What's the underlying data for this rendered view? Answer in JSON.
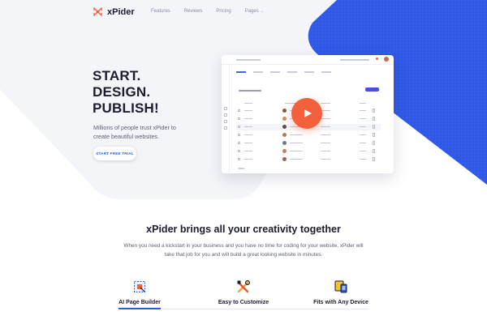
{
  "brand": {
    "name": "xPider",
    "accent": "#f2613c",
    "blue": "#2d5bd7"
  },
  "nav": {
    "links": [
      {
        "label": "Features"
      },
      {
        "label": "Reviews"
      },
      {
        "label": "Pricing"
      },
      {
        "label": "Pages"
      }
    ],
    "dropdown_icon": "chevron-down-icon"
  },
  "hero": {
    "title_lines": [
      "START.",
      "DESIGN.",
      "PUBLISH!"
    ],
    "subtitle": "Millions of people trust xPider to create beautiful websites.",
    "cta_label": "START FREE TRIAL",
    "video_icon": "play-icon"
  },
  "features": {
    "title": "xPider brings all your creativity together",
    "description": "When you need a kickstart in your business and you have no time for coding for your website, xPider will take that job for you and will build a great looking website in minutes.",
    "items": [
      {
        "label": "AI Page Builder",
        "icon": "ai-page-builder-icon",
        "active": true
      },
      {
        "label": "Easy to Customize",
        "icon": "tools-icon",
        "active": false
      },
      {
        "label": "Fits with Any Device",
        "icon": "devices-icon",
        "active": false
      }
    ]
  }
}
